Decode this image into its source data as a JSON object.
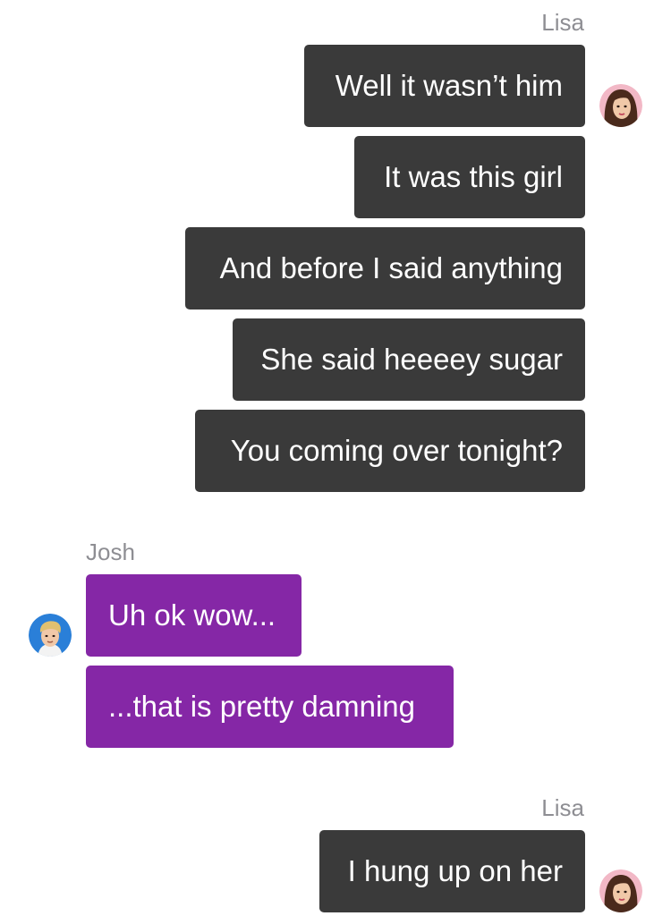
{
  "participants": {
    "lisa": {
      "name": "Lisa",
      "avatar_icon": "woman-avatar-icon"
    },
    "josh": {
      "name": "Josh",
      "avatar_icon": "man-avatar-icon"
    }
  },
  "groups": [
    {
      "sender": "Lisa",
      "messages": [
        "Well it wasn’t him",
        "It was this girl",
        "And before I said anything",
        "She said heeeey sugar",
        "You coming over tonight?"
      ]
    },
    {
      "sender": "Josh",
      "messages": [
        "Uh ok wow...",
        "...that is pretty damning"
      ]
    },
    {
      "sender": "Lisa",
      "messages": [
        "I hung up on her"
      ]
    }
  ],
  "colors": {
    "lisa_bubble": "#3a3a3a",
    "josh_bubble": "#8527a6",
    "sender_label": "#8e8e93",
    "bubble_text": "#ffffff"
  }
}
